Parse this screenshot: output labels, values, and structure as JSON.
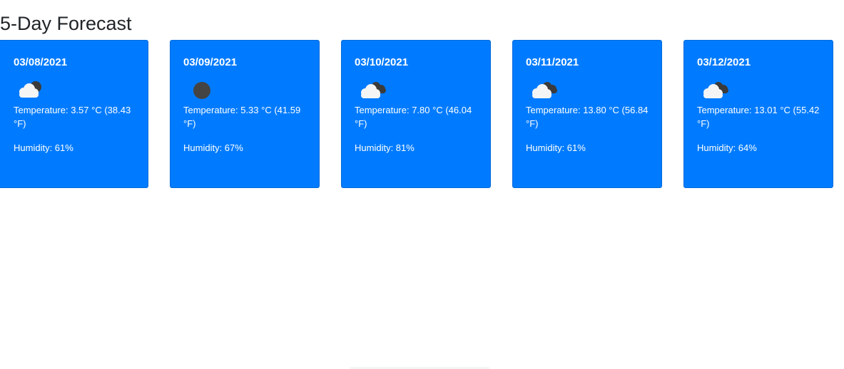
{
  "forecast": {
    "title": "5-Day Forecast",
    "days": [
      {
        "date": "03/08/2021",
        "icon": "partly-cloudy-night-icon",
        "temperature": "Temperature: 3.57 °C (38.43 °F)",
        "humidity": "Humidity: 61%"
      },
      {
        "date": "03/09/2021",
        "icon": "clear-night-moon-icon",
        "temperature": "Temperature: 5.33 °C (41.59 °F)",
        "humidity": "Humidity: 67%"
      },
      {
        "date": "03/10/2021",
        "icon": "broken-clouds-icon",
        "temperature": "Temperature: 7.80 °C (46.04 °F)",
        "humidity": "Humidity: 81%"
      },
      {
        "date": "03/11/2021",
        "icon": "broken-clouds-icon",
        "temperature": "Temperature: 13.80 °C (56.84 °F)",
        "humidity": "Humidity: 61%"
      },
      {
        "date": "03/12/2021",
        "icon": "broken-clouds-icon",
        "temperature": "Temperature: 13.01 °C (55.42 °F)",
        "humidity": "Humidity: 64%"
      }
    ]
  },
  "colors": {
    "card_background": "#007bff",
    "card_text": "#ffffff",
    "title_text": "#212529",
    "cloud_white": "#f5f5f5",
    "cloud_dark": "#3b3b3b",
    "moon_dark": "#444444"
  }
}
